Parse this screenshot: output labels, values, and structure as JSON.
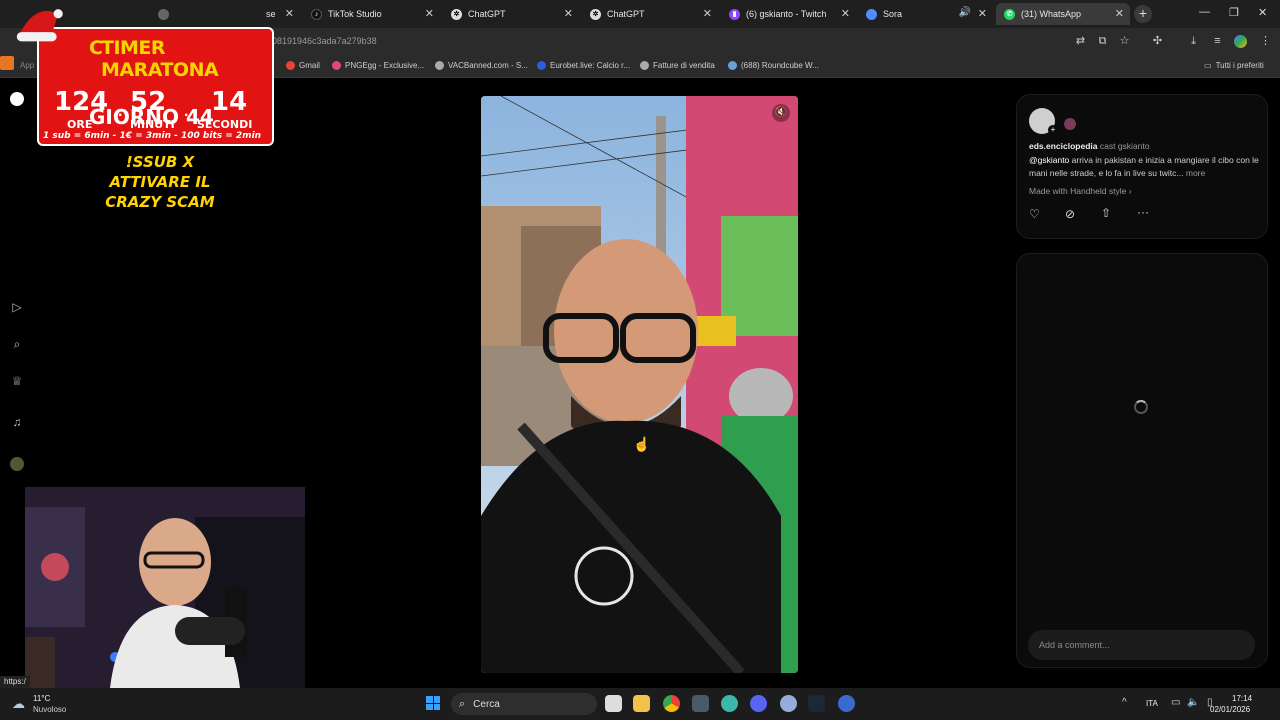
{
  "tabs": [
    {
      "label": "TikTok Studio",
      "icon": "tiktok-icon"
    },
    {
      "label": "ChatGPT",
      "icon": "chatgpt-icon"
    },
    {
      "label": "ChatGPT",
      "icon": "chatgpt-icon"
    },
    {
      "label": "(6) gskianto - Twitch",
      "icon": "twitch-icon"
    },
    {
      "label": "Sora",
      "icon": "sora-icon"
    },
    {
      "label": "(31) WhatsApp",
      "icon": "whatsapp-icon"
    }
  ],
  "hidden_tab_fragment": "se",
  "address": {
    "url": "08191946c3ada7a279b38"
  },
  "bookmarks": [
    {
      "label": "Gmail"
    },
    {
      "label": "PNGEgg - Exclusive..."
    },
    {
      "label": "VACBanned.com - S..."
    },
    {
      "label": "Eurobet.live: Calcio r..."
    },
    {
      "label": "Fatture di vendita"
    },
    {
      "label": "(688) Roundcube W..."
    },
    {
      "label": "Tutti i preferiti"
    }
  ],
  "bookmarks_partial": "App",
  "overlay": {
    "title": "TIMER MARATONA",
    "title_partial": "C",
    "hours": "124",
    "minutes": "52",
    "seconds": "14",
    "hours_label": "ORE",
    "minutes_label": "MINUTI",
    "seconds_label": "SECONDI",
    "day": "GIORNO 44",
    "rules": "1 sub = 6min - 1€ = 3min - 100 bits = 2min"
  },
  "sub_text": {
    "line1": "!SSUB X",
    "line2": "ATTIVARE IL",
    "line3": "CRAZY SCAM"
  },
  "post": {
    "author": "eds.enciclopedia",
    "cast": "cast gskianto",
    "mention": "@gskianto",
    "caption": "arriva in pakistan e inizia a mangiare il cibo con le mani nelle strade, e lo fa in live su twitc...",
    "more": "more",
    "style": "Made with Handheld style",
    "comment_placeholder": "Add a comment..."
  },
  "status_url": "https:/",
  "taskbar": {
    "weather_temp": "11°C",
    "weather_desc": "Nuvoloso",
    "search": "Cerca",
    "lang": "ITA",
    "time": "17:14",
    "date": "02/01/2026"
  },
  "colors": {
    "overlay_red": "#e11313",
    "overlay_yellow": "#f5d400",
    "sub_yellow": "#ffd400",
    "background": "#000000"
  }
}
